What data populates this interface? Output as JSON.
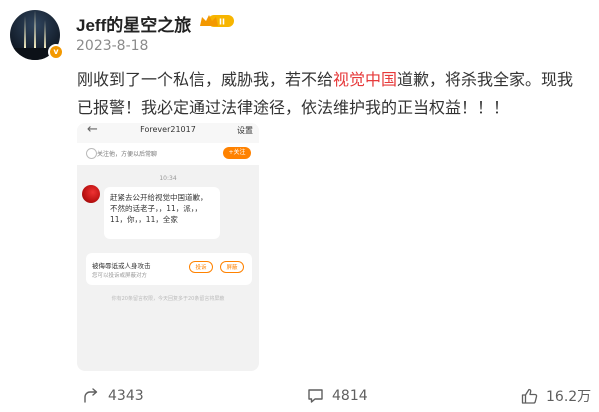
{
  "post": {
    "username": "Jeff的星空之旅",
    "level_badge": "II",
    "verified_badge": "v",
    "date": "2023-8-18",
    "text_part1": "刚收到了一个私信，威胁我，若不给",
    "text_highlight": "视觉中国",
    "text_part2": "道歉，将杀我全家。现我已报警！我必定通过法律途径，依法维护我的正当权益！！！",
    "highlight_color": "#e6393a"
  },
  "screenshot": {
    "back_glyph": "←",
    "title": "Forever21017",
    "settings": "设置",
    "follow_hint": "关注他，方便以后常聊",
    "follow_button": "+关注",
    "time": "10:34",
    "message": "赶紧去公开给视觉中国道歉，不然的话老子，，11，派，，11，你，，11，全家",
    "report_title": "被侮辱诋或人身攻击",
    "report_sub": "您可以投诉或屏蔽对方",
    "complain_button": "投诉",
    "block_button": "屏蔽",
    "footer": "你有20条留言权限，今天回复多于20条留言将屏蔽",
    "accent_color": "#ff8200"
  },
  "actions": {
    "share_count": "4343",
    "comment_count": "4814",
    "like_count": "16.2万"
  }
}
